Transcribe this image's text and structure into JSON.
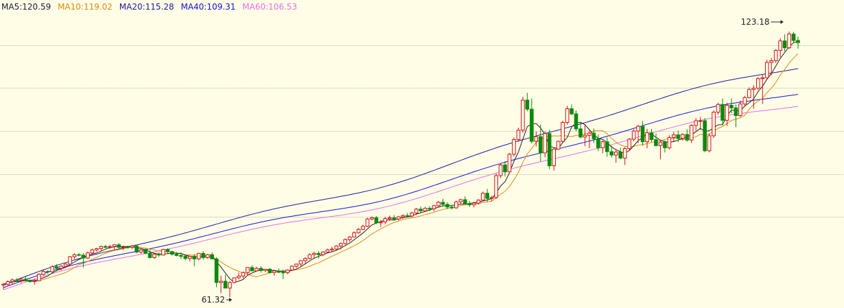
{
  "legend": {
    "ma5": "MA5:120.59",
    "ma10": "MA10:119.02",
    "ma20": "MA20:115.28",
    "ma40": "MA40:109.31",
    "ma60": "MA60:106.53"
  },
  "colors": {
    "background": "#fffde6",
    "grid": "#b9b9a0",
    "up": "#d0101a",
    "down": "#0a8a0a",
    "ma5": "#202020",
    "ma10": "#e08a10",
    "ma20": "#1a1a9c",
    "ma40": "#1010d8",
    "ma60": "#e070e8"
  },
  "annotations": {
    "high_label": "123.18",
    "low_label": "61.32"
  },
  "chart_data": {
    "type": "candlestick",
    "title": "",
    "grid": true,
    "ylim": [
      59,
      128
    ],
    "y_gridlines": [
      80,
      90,
      100,
      110,
      120
    ],
    "candles": [
      [
        64.1,
        64.6,
        63.1,
        64.3
      ],
      [
        64.3,
        65.2,
        63.8,
        64.9
      ],
      [
        64.9,
        65.7,
        64.3,
        65.3
      ],
      [
        65.3,
        65.7,
        64.9,
        65.2
      ],
      [
        65.2,
        65.9,
        64.6,
        65.5
      ],
      [
        65.5,
        66.1,
        65.1,
        65.1
      ],
      [
        65.1,
        65.4,
        64.7,
        64.9
      ],
      [
        64.9,
        65.6,
        64.2,
        65.1
      ],
      [
        65.1,
        66.9,
        65.0,
        66.6
      ],
      [
        66.6,
        67.6,
        66.2,
        67.3
      ],
      [
        67.3,
        67.6,
        66.7,
        67.2
      ],
      [
        67.2,
        68.7,
        67.0,
        68.4
      ],
      [
        68.4,
        69.0,
        67.3,
        68.0
      ],
      [
        68.0,
        68.8,
        67.5,
        68.5
      ],
      [
        68.5,
        69.3,
        68.2,
        69.0
      ],
      [
        69.0,
        70.9,
        68.6,
        70.7
      ],
      [
        70.7,
        71.5,
        70.2,
        71.2
      ],
      [
        71.2,
        71.6,
        70.8,
        71.1
      ],
      [
        71.1,
        71.5,
        68.2,
        70.4
      ],
      [
        70.4,
        71.9,
        70.2,
        71.6
      ],
      [
        71.6,
        72.6,
        71.2,
        72.3
      ],
      [
        72.3,
        72.8,
        71.9,
        72.6
      ],
      [
        72.6,
        73.3,
        72.1,
        73.1
      ],
      [
        73.1,
        73.5,
        72.7,
        72.9
      ],
      [
        72.9,
        73.5,
        72.6,
        73.1
      ],
      [
        73.1,
        73.6,
        72.4,
        73.5
      ],
      [
        73.5,
        73.9,
        72.7,
        72.9
      ],
      [
        72.9,
        73.3,
        72.3,
        73.0
      ],
      [
        73.0,
        73.3,
        72.6,
        72.9
      ],
      [
        72.9,
        73.4,
        72.5,
        73.2
      ],
      [
        73.2,
        73.5,
        71.5,
        71.8
      ],
      [
        71.8,
        72.5,
        71.4,
        72.3
      ],
      [
        72.3,
        72.7,
        71.3,
        71.5
      ],
      [
        71.5,
        72.3,
        70.3,
        70.5
      ],
      [
        70.5,
        71.4,
        70.2,
        71.3
      ],
      [
        71.3,
        71.7,
        70.7,
        71.1
      ],
      [
        71.1,
        72.6,
        71.0,
        72.4
      ],
      [
        72.4,
        72.7,
        71.5,
        71.9
      ],
      [
        71.9,
        72.1,
        71.0,
        71.3
      ],
      [
        71.3,
        71.8,
        70.8,
        71.0
      ],
      [
        71.0,
        71.7,
        70.2,
        70.8
      ],
      [
        70.8,
        71.1,
        69.9,
        70.3
      ],
      [
        70.3,
        70.9,
        69.6,
        70.8
      ],
      [
        70.8,
        71.3,
        68.5,
        70.2
      ],
      [
        70.2,
        71.3,
        69.9,
        71.5
      ],
      [
        71.5,
        72.0,
        70.0,
        70.5
      ],
      [
        70.5,
        71.4,
        70.2,
        71.2
      ],
      [
        71.2,
        71.7,
        70.5,
        70.2
      ],
      [
        70.2,
        70.6,
        63.6,
        64.7
      ],
      [
        64.7,
        66.3,
        62.2,
        65.0
      ],
      [
        65.0,
        66.5,
        63.6,
        63.4
      ],
      [
        63.4,
        65.0,
        61.3,
        64.7
      ],
      [
        64.7,
        65.9,
        64.5,
        65.8
      ],
      [
        65.8,
        67.0,
        65.4,
        66.2
      ],
      [
        66.2,
        67.3,
        65.7,
        67.0
      ],
      [
        67.0,
        68.3,
        66.4,
        68.2
      ],
      [
        68.2,
        68.7,
        67.7,
        67.4
      ],
      [
        67.4,
        68.4,
        67.2,
        68.0
      ],
      [
        68.0,
        68.5,
        67.0,
        67.5
      ],
      [
        67.5,
        67.9,
        67.1,
        67.8
      ],
      [
        67.8,
        68.1,
        66.8,
        67.0
      ],
      [
        67.0,
        67.5,
        66.3,
        67.4
      ],
      [
        67.4,
        68.0,
        66.9,
        67.1
      ],
      [
        67.1,
        67.7,
        65.5,
        67.0
      ],
      [
        67.0,
        67.8,
        66.6,
        67.6
      ],
      [
        67.6,
        68.7,
        67.4,
        68.5
      ],
      [
        68.5,
        69.1,
        68.1,
        69.0
      ],
      [
        69.0,
        69.9,
        68.5,
        69.8
      ],
      [
        69.8,
        70.6,
        69.1,
        70.3
      ],
      [
        70.3,
        71.5,
        70.1,
        71.2
      ],
      [
        71.2,
        71.9,
        70.2,
        71.5
      ],
      [
        71.5,
        72.0,
        70.3,
        71.2
      ],
      [
        71.2,
        72.0,
        70.8,
        71.8
      ],
      [
        71.8,
        72.6,
        71.6,
        72.3
      ],
      [
        72.3,
        73.0,
        71.9,
        72.5
      ],
      [
        72.5,
        73.4,
        72.3,
        73.2
      ],
      [
        73.2,
        74.0,
        72.4,
        73.8
      ],
      [
        73.8,
        75.0,
        73.5,
        74.7
      ],
      [
        74.7,
        75.5,
        74.2,
        75.3
      ],
      [
        75.3,
        76.6,
        75.2,
        76.3
      ],
      [
        76.3,
        77.4,
        76.1,
        77.1
      ],
      [
        77.1,
        78.2,
        76.9,
        77.8
      ],
      [
        77.8,
        79.8,
        77.6,
        79.5
      ],
      [
        79.5,
        80.1,
        79.2,
        79.8
      ],
      [
        79.8,
        80.2,
        78.3,
        78.6
      ],
      [
        78.6,
        79.3,
        77.6,
        78.8
      ],
      [
        78.8,
        80.0,
        78.3,
        79.6
      ],
      [
        79.6,
        80.3,
        79.0,
        79.8
      ],
      [
        79.8,
        80.4,
        79.1,
        79.5
      ],
      [
        79.5,
        80.2,
        79.2,
        80.0
      ],
      [
        80.0,
        80.6,
        79.6,
        80.3
      ],
      [
        80.3,
        80.9,
        79.9,
        80.2
      ],
      [
        80.2,
        81.2,
        79.9,
        80.9
      ],
      [
        80.9,
        82.1,
        80.4,
        81.8
      ],
      [
        81.8,
        82.4,
        80.9,
        81.4
      ],
      [
        81.4,
        82.3,
        81.2,
        82.0
      ],
      [
        82.0,
        82.5,
        81.3,
        81.9
      ],
      [
        81.9,
        82.8,
        81.3,
        82.6
      ],
      [
        82.6,
        83.7,
        82.3,
        83.4
      ],
      [
        83.4,
        84.2,
        82.6,
        82.9
      ],
      [
        82.9,
        83.4,
        81.8,
        82.3
      ],
      [
        82.3,
        82.8,
        81.7,
        82.1
      ],
      [
        82.1,
        83.8,
        81.9,
        83.5
      ],
      [
        83.5,
        84.2,
        82.9,
        84.0
      ],
      [
        84.0,
        84.8,
        83.0,
        83.1
      ],
      [
        83.1,
        83.7,
        82.3,
        82.8
      ],
      [
        82.8,
        83.5,
        82.2,
        83.2
      ],
      [
        83.2,
        84.1,
        82.8,
        83.9
      ],
      [
        83.9,
        85.9,
        83.7,
        85.5
      ],
      [
        85.5,
        86.5,
        83.5,
        84.3
      ],
      [
        84.3,
        84.9,
        83.6,
        84.5
      ],
      [
        84.5,
        90.1,
        84.2,
        89.6
      ],
      [
        89.6,
        92.5,
        89.1,
        92.1
      ],
      [
        92.1,
        93.0,
        89.4,
        90.5
      ],
      [
        90.5,
        94.9,
        90.2,
        94.6
      ],
      [
        94.6,
        98.5,
        94.1,
        98.0
      ],
      [
        98.0,
        100.8,
        97.5,
        100.2
      ],
      [
        100.2,
        108.0,
        99.6,
        107.2
      ],
      [
        107.2,
        108.9,
        104.6,
        105.1
      ],
      [
        105.1,
        107.6,
        97.1,
        97.6
      ],
      [
        97.6,
        99.9,
        96.4,
        98.7
      ],
      [
        98.7,
        101.5,
        92.9,
        94.9
      ],
      [
        94.9,
        100.0,
        93.9,
        99.4
      ],
      [
        99.4,
        100.3,
        91.1,
        91.9
      ],
      [
        91.9,
        96.1,
        90.8,
        95.8
      ],
      [
        95.8,
        97.8,
        95.6,
        97.6
      ],
      [
        97.6,
        102.4,
        97.3,
        102.0
      ],
      [
        102.0,
        105.9,
        101.5,
        105.2
      ],
      [
        105.2,
        106.2,
        103.7,
        104.0
      ],
      [
        104.0,
        104.8,
        100.0,
        100.5
      ],
      [
        100.5,
        101.9,
        98.3,
        98.6
      ],
      [
        98.6,
        101.6,
        96.5,
        99.0
      ],
      [
        99.0,
        100.3,
        96.0,
        99.5
      ],
      [
        99.5,
        100.6,
        97.2,
        98.2
      ],
      [
        98.2,
        99.2,
        95.3,
        96.1
      ],
      [
        96.1,
        97.8,
        94.8,
        97.5
      ],
      [
        97.5,
        98.5,
        94.0,
        95.2
      ],
      [
        95.2,
        96.6,
        93.8,
        94.4
      ],
      [
        94.4,
        95.7,
        92.6,
        95.1
      ],
      [
        95.1,
        96.1,
        93.4,
        93.7
      ],
      [
        93.7,
        96.3,
        92.1,
        95.9
      ],
      [
        95.9,
        98.4,
        95.6,
        98.1
      ],
      [
        98.1,
        100.4,
        97.6,
        100.0
      ],
      [
        100.0,
        101.5,
        97.2,
        101.1
      ],
      [
        101.1,
        102.3,
        96.6,
        97.5
      ],
      [
        97.5,
        100.5,
        96.0,
        99.6
      ],
      [
        99.6,
        100.5,
        97.4,
        98.0
      ],
      [
        98.0,
        99.4,
        96.4,
        96.6
      ],
      [
        96.6,
        98.0,
        93.4,
        97.4
      ],
      [
        97.4,
        97.8,
        95.0,
        96.1
      ],
      [
        96.1,
        99.0,
        95.7,
        98.5
      ],
      [
        98.5,
        99.8,
        97.6,
        99.1
      ],
      [
        99.1,
        100.1,
        97.4,
        98.3
      ],
      [
        98.3,
        99.5,
        97.8,
        99.2
      ],
      [
        99.2,
        100.4,
        97.5,
        97.9
      ],
      [
        97.9,
        101.6,
        97.2,
        101.3
      ],
      [
        101.3,
        103.0,
        100.0,
        102.4
      ],
      [
        102.4,
        103.3,
        100.3,
        102.4
      ],
      [
        102.4,
        103.0,
        95.1,
        95.4
      ],
      [
        95.4,
        99.4,
        95.0,
        98.9
      ],
      [
        98.9,
        104.8,
        98.4,
        104.4
      ],
      [
        104.4,
        106.6,
        103.8,
        106.2
      ],
      [
        106.2,
        107.6,
        101.3,
        102.5
      ],
      [
        102.5,
        106.6,
        101.2,
        106.0
      ],
      [
        106.0,
        107.6,
        104.1,
        105.4
      ],
      [
        105.4,
        106.2,
        100.9,
        103.6
      ],
      [
        103.6,
        107.1,
        103.3,
        106.3
      ],
      [
        106.3,
        108.2,
        105.7,
        107.8
      ],
      [
        107.8,
        110.2,
        107.6,
        109.7
      ],
      [
        109.7,
        110.7,
        105.2,
        110.0
      ],
      [
        110.0,
        112.6,
        109.6,
        112.2
      ],
      [
        112.2,
        113.2,
        106.3,
        112.4
      ],
      [
        112.4,
        116.6,
        112.2,
        116.0
      ],
      [
        116.0,
        117.0,
        113.0,
        116.4
      ],
      [
        116.4,
        119.1,
        115.9,
        118.8
      ],
      [
        118.8,
        121.6,
        117.2,
        121.0
      ],
      [
        121.0,
        122.5,
        118.6,
        119.4
      ],
      [
        119.4,
        123.2,
        119.1,
        122.6
      ],
      [
        122.6,
        123.1,
        120.5,
        121.1
      ],
      [
        121.1,
        122.0,
        119.2,
        120.6
      ]
    ],
    "ma_series": [
      {
        "name": "MA20",
        "color": "#1a1a9c",
        "from": {
          "index": 0,
          "value": 64.1
        },
        "to": {
          "index": 179,
          "value": 115.3
        }
      },
      {
        "name": "MA40",
        "color": "#1010d8",
        "from": {
          "index": 0,
          "value": 63.5
        },
        "to": {
          "index": 179,
          "value": 109.3
        }
      },
      {
        "name": "MA60",
        "color": "#e070e8",
        "from": {
          "index": 0,
          "value": 63.0
        },
        "to": {
          "index": 179,
          "value": 106.5
        }
      }
    ],
    "marked_high": {
      "index": 176,
      "value": 123.18
    },
    "marked_low": {
      "index": 51,
      "value": 61.32
    }
  }
}
